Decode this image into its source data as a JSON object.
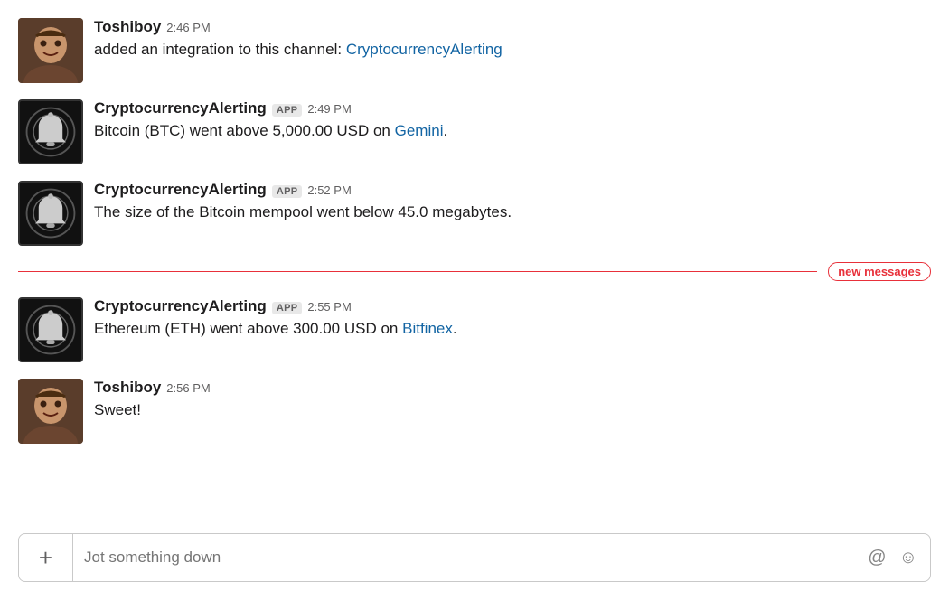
{
  "messages": [
    {
      "id": "msg1",
      "type": "human",
      "sender": "Toshiboy",
      "timestamp": "2:46 PM",
      "isApp": false,
      "text_plain": "added an integration to this channel: ",
      "text_link": "CryptocurrencyAlerting",
      "text_link_url": "#"
    },
    {
      "id": "msg2",
      "type": "bot",
      "sender": "CryptocurrencyAlerting",
      "timestamp": "2:49 PM",
      "isApp": true,
      "text_plain": "Bitcoin (BTC) went above 5,000.00 USD on ",
      "text_link": "Gemini",
      "text_link_url": "#",
      "text_suffix": "."
    },
    {
      "id": "msg3",
      "type": "bot",
      "sender": "CryptocurrencyAlerting",
      "timestamp": "2:52 PM",
      "isApp": true,
      "text_plain": "The size of the Bitcoin mempool went below 45.0 megabytes.",
      "text_link": null,
      "text_link_url": null,
      "text_suffix": null
    },
    {
      "id": "msg4",
      "type": "bot",
      "sender": "CryptocurrencyAlerting",
      "timestamp": "2:55 PM",
      "isApp": true,
      "text_plain": "Ethereum (ETH) went above 300.00 USD on ",
      "text_link": "Bitfinex",
      "text_link_url": "#",
      "text_suffix": "."
    },
    {
      "id": "msg5",
      "type": "human",
      "sender": "Toshiboy",
      "timestamp": "2:56 PM",
      "isApp": false,
      "text_plain": "Sweet!",
      "text_link": null,
      "text_link_url": null,
      "text_suffix": null
    }
  ],
  "new_messages_divider_index": 3,
  "new_messages_label": "new messages",
  "input": {
    "placeholder": "Jot something down",
    "add_icon": "+",
    "at_icon": "@",
    "emoji_icon": "☺"
  },
  "labels": {
    "app_badge": "APP"
  }
}
